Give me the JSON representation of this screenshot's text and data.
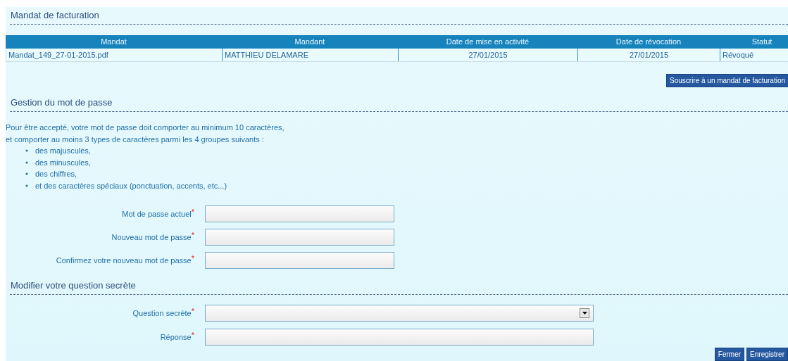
{
  "billing_mandate": {
    "title": "Mandat de facturation",
    "table": {
      "columns": [
        "Mandat",
        "Mandant",
        "Date de mise en activité",
        "Date de révocation",
        "Statut"
      ],
      "rows": [
        [
          "Mandat_149_27-01-2015.pdf",
          "MATTHIEU DELAMARE",
          "27/01/2015",
          "27/01/2015",
          "Révoqué"
        ]
      ]
    },
    "subscribe_button": "Souscrire à un mandat de facturation"
  },
  "password": {
    "title": "Gestion du mot de passe",
    "intro": [
      "Pour être accepté, votre mot de passe doit comporter au minimum 10 caractères,",
      "et comporter au moins 3 types de caractères parmi les 4 groupes suivants :"
    ],
    "rules": [
      "des majuscules,",
      "des minuscules,",
      "des chiffres,",
      "et des caractères spéciaux (ponctuation, accents, etc...)"
    ],
    "fields": [
      {
        "label": "Mot de passe actuel",
        "required_mark": "*",
        "kind": "text"
      },
      {
        "label": "Nouveau mot de passe",
        "required_mark": "*",
        "kind": "text"
      },
      {
        "label": "Confirmez votre nouveau mot de passe",
        "required_mark": "*",
        "kind": "text"
      }
    ]
  },
  "secret_question": {
    "title": "Modifier votre question secrète",
    "fields": [
      {
        "label": "Question secrète",
        "required_mark": "*",
        "kind": "select"
      },
      {
        "label": "Réponse",
        "required_mark": "*",
        "kind": "text"
      }
    ]
  },
  "buttons": [
    "Fermer",
    "Enregistrer"
  ]
}
